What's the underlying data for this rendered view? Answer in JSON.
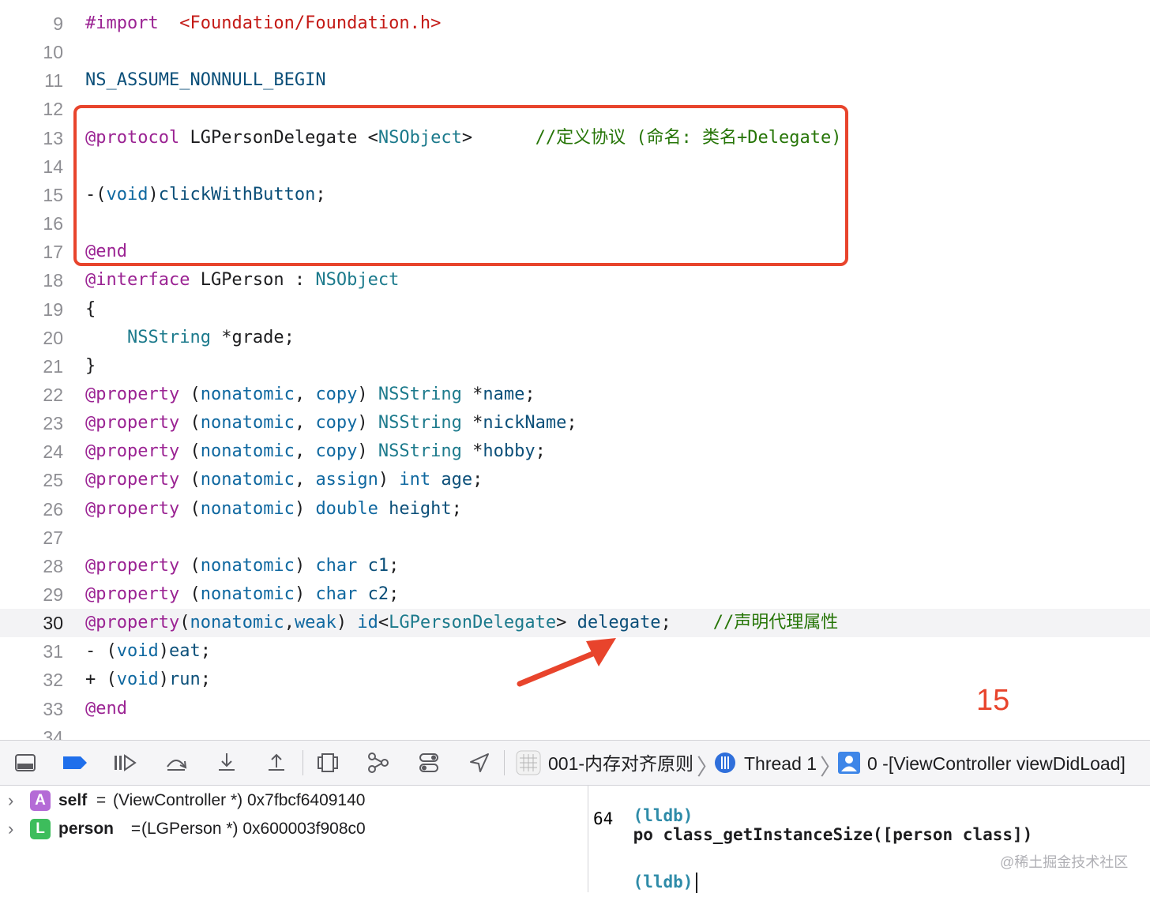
{
  "editor": {
    "lines": [
      {
        "n": "9",
        "seg": [
          [
            "kw-p",
            "#import"
          ],
          [
            "",
            "  "
          ],
          [
            "str",
            "<Foundation/Foundation.h>"
          ]
        ]
      },
      {
        "n": "10",
        "seg": []
      },
      {
        "n": "11",
        "seg": [
          [
            "kw-b",
            "NS_ASSUME_NONNULL_BEGIN"
          ]
        ]
      },
      {
        "n": "12",
        "seg": []
      },
      {
        "n": "13",
        "seg": [
          [
            "kw-p",
            "@protocol"
          ],
          [
            "",
            " LGPersonDelegate <"
          ],
          [
            "cls",
            "NSObject"
          ],
          [
            "",
            ">      "
          ],
          [
            "cmt",
            "//定义协议 (命名: 类名+Delegate)"
          ]
        ]
      },
      {
        "n": "14",
        "seg": []
      },
      {
        "n": "15",
        "seg": [
          [
            "",
            "-("
          ],
          [
            "kw-t",
            "void"
          ],
          [
            "",
            ")"
          ],
          [
            "kw-b",
            "clickWithButton"
          ],
          [
            "",
            ";"
          ]
        ]
      },
      {
        "n": "16",
        "seg": []
      },
      {
        "n": "17",
        "seg": [
          [
            "kw-p",
            "@end"
          ]
        ]
      },
      {
        "n": "18",
        "seg": [
          [
            "kw-p",
            "@interface"
          ],
          [
            "",
            " LGPerson : "
          ],
          [
            "cls",
            "NSObject"
          ]
        ]
      },
      {
        "n": "19",
        "seg": [
          [
            "",
            "{"
          ]
        ]
      },
      {
        "n": "20",
        "seg": [
          [
            "",
            "    "
          ],
          [
            "cls",
            "NSString"
          ],
          [
            "",
            " *grade;"
          ]
        ]
      },
      {
        "n": "21",
        "seg": [
          [
            "",
            "}"
          ]
        ]
      },
      {
        "n": "22",
        "seg": [
          [
            "kw-p",
            "@property"
          ],
          [
            "",
            " ("
          ],
          [
            "kw-t",
            "nonatomic"
          ],
          [
            "",
            ", "
          ],
          [
            "kw-t",
            "copy"
          ],
          [
            "",
            ") "
          ],
          [
            "cls",
            "NSString"
          ],
          [
            "",
            " *"
          ],
          [
            "kw-b",
            "name"
          ],
          [
            "",
            ";"
          ]
        ]
      },
      {
        "n": "23",
        "seg": [
          [
            "kw-p",
            "@property"
          ],
          [
            "",
            " ("
          ],
          [
            "kw-t",
            "nonatomic"
          ],
          [
            "",
            ", "
          ],
          [
            "kw-t",
            "copy"
          ],
          [
            "",
            ") "
          ],
          [
            "cls",
            "NSString"
          ],
          [
            "",
            " *"
          ],
          [
            "kw-b",
            "nickName"
          ],
          [
            "",
            ";"
          ]
        ]
      },
      {
        "n": "24",
        "seg": [
          [
            "kw-p",
            "@property"
          ],
          [
            "",
            " ("
          ],
          [
            "kw-t",
            "nonatomic"
          ],
          [
            "",
            ", "
          ],
          [
            "kw-t",
            "copy"
          ],
          [
            "",
            ") "
          ],
          [
            "cls",
            "NSString"
          ],
          [
            "",
            " *"
          ],
          [
            "kw-b",
            "hobby"
          ],
          [
            "",
            ";"
          ]
        ]
      },
      {
        "n": "25",
        "seg": [
          [
            "kw-p",
            "@property"
          ],
          [
            "",
            " ("
          ],
          [
            "kw-t",
            "nonatomic"
          ],
          [
            "",
            ", "
          ],
          [
            "kw-t",
            "assign"
          ],
          [
            "",
            ") "
          ],
          [
            "kw-t",
            "int"
          ],
          [
            "",
            " "
          ],
          [
            "kw-b",
            "age"
          ],
          [
            "",
            ";"
          ]
        ]
      },
      {
        "n": "26",
        "seg": [
          [
            "kw-p",
            "@property"
          ],
          [
            "",
            " ("
          ],
          [
            "kw-t",
            "nonatomic"
          ],
          [
            "",
            ") "
          ],
          [
            "kw-t",
            "double"
          ],
          [
            "",
            " "
          ],
          [
            "kw-b",
            "height"
          ],
          [
            "",
            ";"
          ]
        ]
      },
      {
        "n": "27",
        "seg": []
      },
      {
        "n": "28",
        "seg": [
          [
            "kw-p",
            "@property"
          ],
          [
            "",
            " ("
          ],
          [
            "kw-t",
            "nonatomic"
          ],
          [
            "",
            ") "
          ],
          [
            "kw-t",
            "char"
          ],
          [
            "",
            " "
          ],
          [
            "kw-b",
            "c1"
          ],
          [
            "",
            ";"
          ]
        ]
      },
      {
        "n": "29",
        "seg": [
          [
            "kw-p",
            "@property"
          ],
          [
            "",
            " ("
          ],
          [
            "kw-t",
            "nonatomic"
          ],
          [
            "",
            ") "
          ],
          [
            "kw-t",
            "char"
          ],
          [
            "",
            " "
          ],
          [
            "kw-b",
            "c2"
          ],
          [
            "",
            ";"
          ]
        ]
      },
      {
        "n": "30",
        "seg": [
          [
            "kw-p",
            "@property"
          ],
          [
            "",
            "("
          ],
          [
            "kw-t",
            "nonatomic"
          ],
          [
            "",
            ","
          ],
          [
            "kw-t",
            "weak"
          ],
          [
            "",
            ") "
          ],
          [
            "kw-t",
            "id"
          ],
          [
            "",
            "<"
          ],
          [
            "cls",
            "LGPersonDelegate"
          ],
          [
            "",
            "> "
          ],
          [
            "kw-b",
            "delegate"
          ],
          [
            "",
            ";    "
          ],
          [
            "cmt",
            "//声明代理属性"
          ]
        ],
        "current": true
      },
      {
        "n": "31",
        "seg": [
          [
            "",
            "- ("
          ],
          [
            "kw-t",
            "void"
          ],
          [
            "",
            ")"
          ],
          [
            "kw-b",
            "eat"
          ],
          [
            "",
            ";"
          ]
        ]
      },
      {
        "n": "32",
        "seg": [
          [
            "",
            "+ ("
          ],
          [
            "kw-t",
            "void"
          ],
          [
            "",
            ")"
          ],
          [
            "kw-b",
            "run"
          ],
          [
            "",
            ";"
          ]
        ]
      },
      {
        "n": "33",
        "seg": [
          [
            "kw-p",
            "@end"
          ]
        ]
      },
      {
        "n": "34",
        "seg": []
      }
    ],
    "annotation_number": "15"
  },
  "debug_bar": {
    "scheme": "001-内存对齐原则",
    "thread": "Thread 1",
    "frame": "0 -[ViewController viewDidLoad]"
  },
  "variables": [
    {
      "badge": "A",
      "badge_color": "#b46bd6",
      "name": "self",
      "eq": " = ",
      "value": "(ViewController *) 0x7fbcf6409140"
    },
    {
      "badge": "L",
      "badge_color": "#3dbd5c",
      "name": "person",
      "eq": " = ",
      "value": "(LGPerson *) 0x600003f908c0"
    }
  ],
  "console": {
    "prompt": "(lldb)",
    "command": "po class_getInstanceSize([person class])",
    "output": "64",
    "prompt2": "(lldb)"
  },
  "watermark": "@稀土掘金技术社区"
}
